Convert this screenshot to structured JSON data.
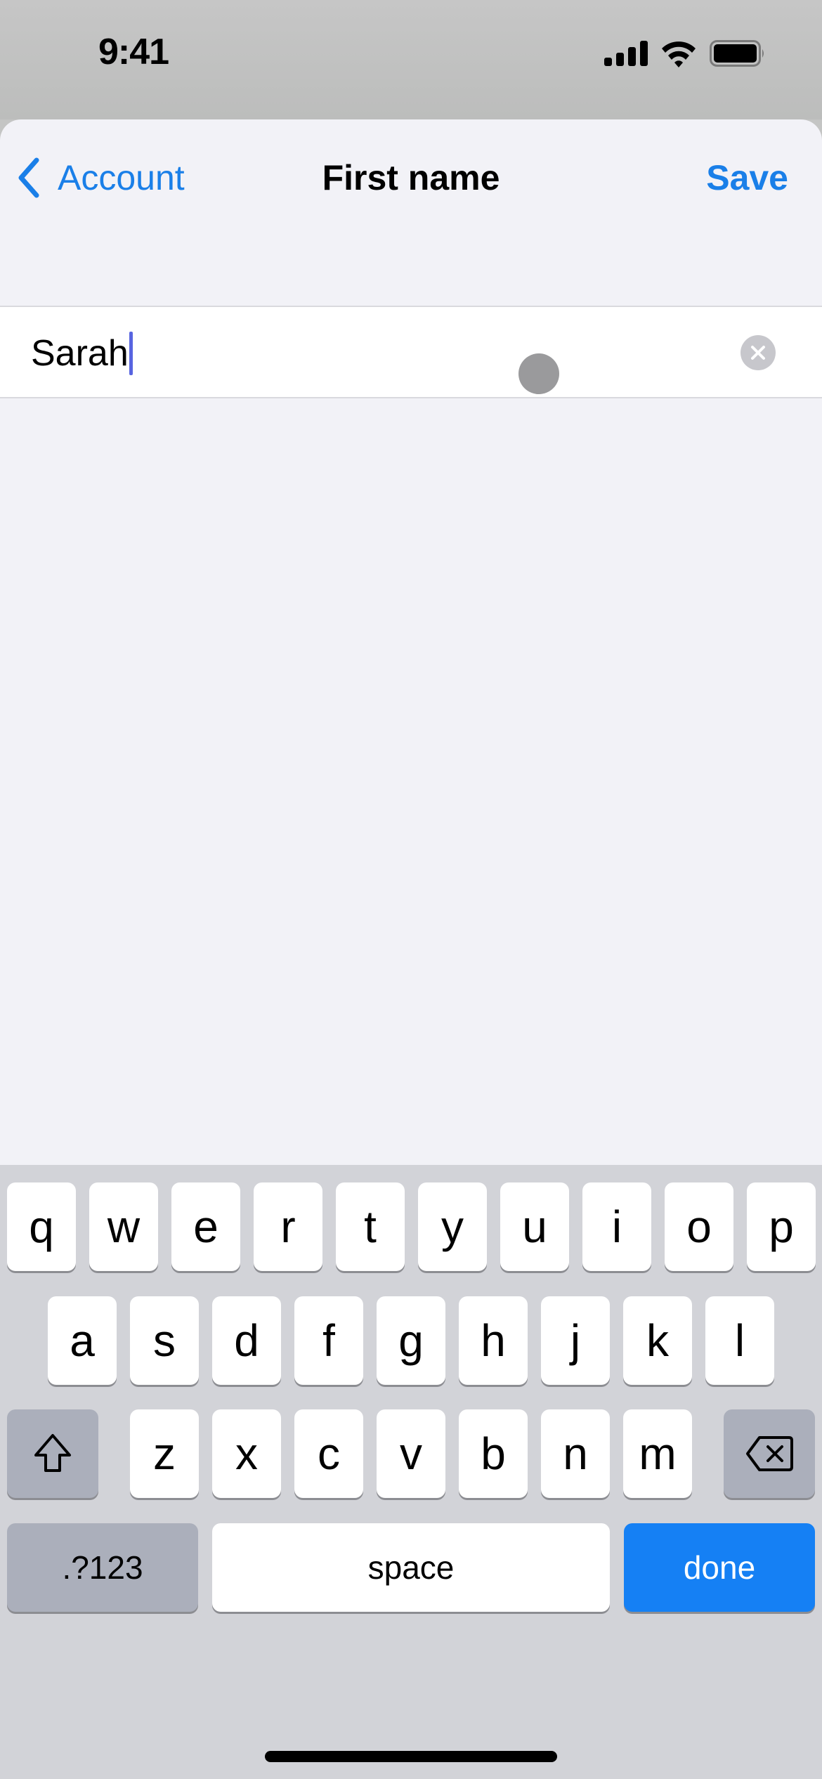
{
  "status_bar": {
    "time": "9:41"
  },
  "nav": {
    "back_label": "Account",
    "title": "First name",
    "save_label": "Save"
  },
  "field": {
    "value": "Sarah",
    "clear_icon": "clear-circle-icon"
  },
  "keyboard": {
    "row1": [
      "q",
      "w",
      "e",
      "r",
      "t",
      "y",
      "u",
      "i",
      "o",
      "p"
    ],
    "row2": [
      "a",
      "s",
      "d",
      "f",
      "g",
      "h",
      "j",
      "k",
      "l"
    ],
    "row3": [
      "z",
      "x",
      "c",
      "v",
      "b",
      "n",
      "m"
    ],
    "numbers_label": ".?123",
    "space_label": "space",
    "done_label": "done"
  },
  "colors": {
    "accent": "#1a7fe8",
    "done_key": "#1580f4",
    "caret": "#5865e0"
  }
}
